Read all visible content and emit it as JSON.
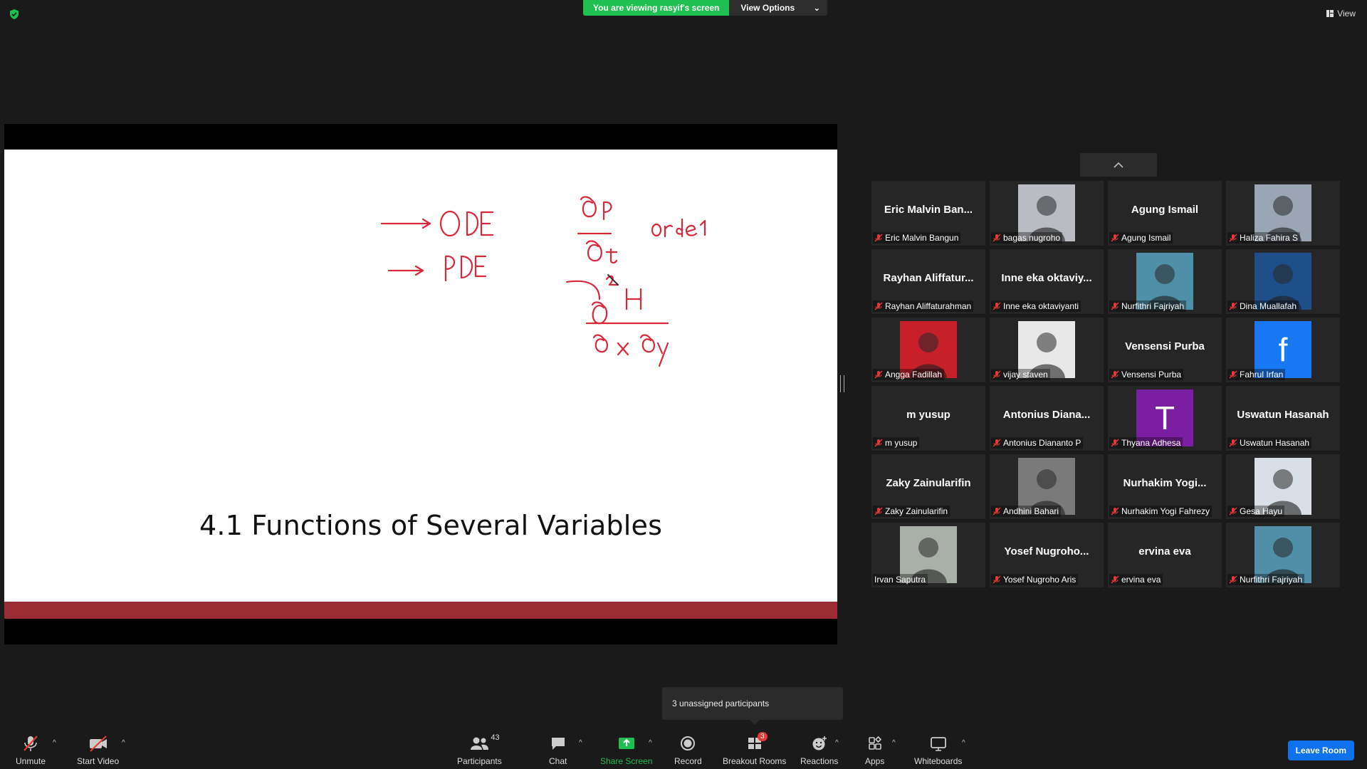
{
  "top": {
    "viewing_label": "You are viewing rasyif's screen",
    "view_options_label": "View Options",
    "view_label": "View"
  },
  "slide": {
    "title": "4.1 Functions of Several Variables",
    "annotations": [
      "→ ODE",
      "→ PDE",
      "∂P / ∂t",
      "orde 1",
      "∂²H / ∂x∂y"
    ]
  },
  "participants": [
    {
      "display": "Eric Malvin Ban...",
      "label": "Eric Malvin Bangun",
      "type": "text",
      "muted": true
    },
    {
      "display": "",
      "label": "bagas nugroho",
      "type": "photo",
      "color": "#b9bcc3",
      "muted": true
    },
    {
      "display": "Agung Ismail",
      "label": "Agung Ismail",
      "type": "text",
      "muted": true
    },
    {
      "display": "",
      "label": "Haliza Fahira S",
      "type": "photo",
      "color": "#9aa6b3",
      "muted": true
    },
    {
      "display": "Rayhan Aliffatur...",
      "label": "Rayhan Aliffaturahman",
      "type": "text",
      "muted": true
    },
    {
      "display": "Inne eka oktaviy...",
      "label": "Inne eka oktaviyanti",
      "type": "text",
      "muted": true
    },
    {
      "display": "",
      "label": "Nurfithri Fajriyah",
      "type": "photo",
      "color": "#4f8fa8",
      "muted": true
    },
    {
      "display": "",
      "label": "Dina Muallafah",
      "type": "photo",
      "color": "#1e4f8a",
      "muted": true
    },
    {
      "display": "",
      "label": "Angga Fadillah",
      "type": "photo",
      "color": "#c8202a",
      "muted": true
    },
    {
      "display": "",
      "label": "vijay staven",
      "type": "photo",
      "color": "#e8e8e8",
      "muted": true
    },
    {
      "display": "Vensensi Purba",
      "label": "Vensensi Purba",
      "type": "text",
      "muted": true
    },
    {
      "display": "f",
      "label": "Fahrul Irfan",
      "type": "letter",
      "color": "#1877f2",
      "muted": true
    },
    {
      "display": "m yusup",
      "label": "m yusup",
      "type": "text",
      "muted": true
    },
    {
      "display": "Antonius Diana...",
      "label": "Antonius Diananto P",
      "type": "text",
      "muted": true
    },
    {
      "display": "T",
      "label": "Thyana Adhesa",
      "type": "letter",
      "color": "#7b1fa2",
      "muted": true
    },
    {
      "display": "Uswatun Hasanah",
      "label": "Uswatun Hasanah",
      "type": "text",
      "muted": true
    },
    {
      "display": "Zaky Zainularifin",
      "label": "Zaky Zainularifin",
      "type": "text",
      "muted": true
    },
    {
      "display": "",
      "label": "Andhini Bahari",
      "type": "photo",
      "color": "#7a7a7a",
      "muted": true
    },
    {
      "display": "Nurhakim Yogi...",
      "label": "Nurhakim Yogi Fahrezy",
      "type": "text",
      "muted": true
    },
    {
      "display": "",
      "label": "Gesa Hayu",
      "type": "photo",
      "color": "#d9dfe6",
      "muted": true
    },
    {
      "display": "",
      "label": "Irvan Saputra",
      "type": "photo",
      "color": "#a9b0a8",
      "muted": false
    },
    {
      "display": "Yosef Nugroho...",
      "label": "Yosef Nugroho Aris",
      "type": "text",
      "muted": true
    },
    {
      "display": "ervina eva",
      "label": "ervina eva",
      "type": "text",
      "muted": true
    },
    {
      "display": "",
      "label": "Nurfithri Fajriyah",
      "type": "photo",
      "color": "#4f8fa8",
      "muted": true
    }
  ],
  "tooltip": "3 unassigned participants",
  "toolbar": {
    "unmute": "Unmute",
    "start_video": "Start Video",
    "participants": "Participants",
    "participants_count": "43",
    "chat": "Chat",
    "share_screen": "Share Screen",
    "record": "Record",
    "breakout_rooms": "Breakout Rooms",
    "breakout_badge": "3",
    "reactions": "Reactions",
    "apps": "Apps",
    "whiteboards": "Whiteboards",
    "leave": "Leave Room"
  },
  "colors": {
    "accent_green": "#1fbf52",
    "leave_blue": "#0e72ed",
    "mute_red": "#e53935",
    "slide_bar": "#9b2b35"
  }
}
